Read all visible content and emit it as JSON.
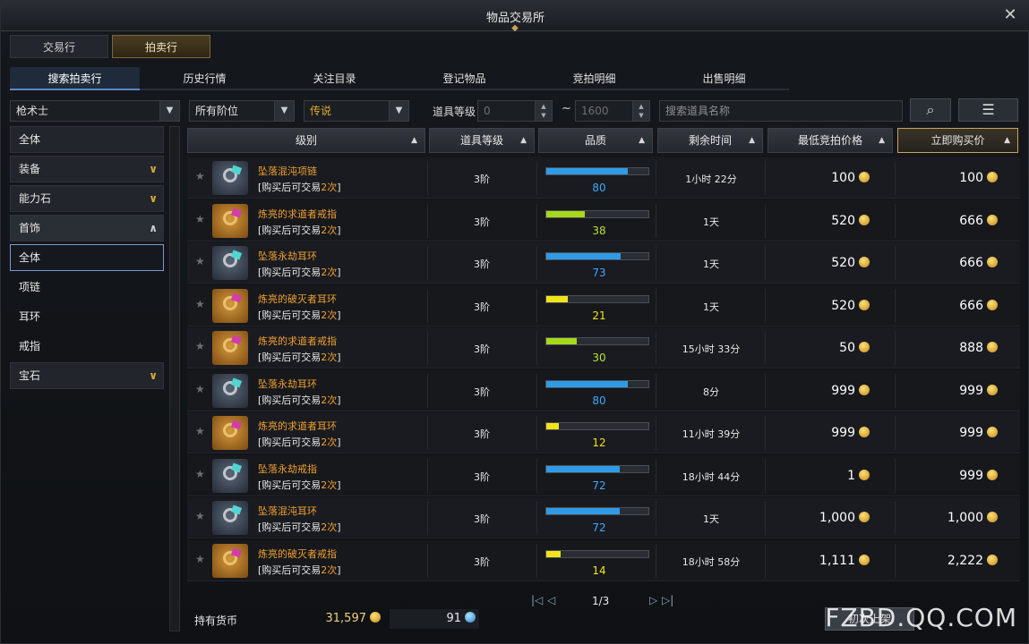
{
  "window": {
    "title": "物品交易所"
  },
  "main_tabs": [
    {
      "label": "交易行"
    },
    {
      "label": "拍卖行"
    }
  ],
  "sub_tabs": [
    {
      "label": "搜索拍卖行"
    },
    {
      "label": "历史行情"
    },
    {
      "label": "关注目录"
    },
    {
      "label": "登记物品"
    },
    {
      "label": "竞拍明细"
    },
    {
      "label": "出售明细"
    }
  ],
  "filters": {
    "class_value": "枪术士",
    "tier_value": "所有阶位",
    "grade_value": "传说",
    "item_level_label": "道具等级",
    "level_min_placeholder": "0",
    "level_max_placeholder": "1600",
    "search_placeholder": "搜索道具名称"
  },
  "sidebar": {
    "categories": [
      {
        "label": "全体"
      },
      {
        "label": "装备"
      },
      {
        "label": "能力石"
      },
      {
        "label": "首饰"
      }
    ],
    "subcategories": [
      {
        "label": "全体"
      },
      {
        "label": "项链"
      },
      {
        "label": "耳环"
      },
      {
        "label": "戒指"
      }
    ],
    "last_category": {
      "label": "宝石"
    }
  },
  "table": {
    "columns": [
      "级别",
      "道具等级",
      "品质",
      "剩余时间",
      "最低竞拍价格",
      "立即购买价"
    ],
    "rows": [
      {
        "name": "坠落混沌项链",
        "note_pre": "[购买后可交易",
        "note_hl": "2次",
        "note_post": "]",
        "tier": "3阶",
        "quality": 80,
        "time": "1小时 22分",
        "min_bid": "100",
        "buy_now": "100",
        "thumb": "blue"
      },
      {
        "name": "炼亮的求道者戒指",
        "note_pre": "[购买后可交易",
        "note_hl": "2次",
        "note_post": "]",
        "tier": "3阶",
        "quality": 38,
        "time": "1天",
        "min_bid": "520",
        "buy_now": "666",
        "thumb": "ring"
      },
      {
        "name": "坠落永劫耳环",
        "note_pre": "[购买后可交易",
        "note_hl": "2次",
        "note_post": "]",
        "tier": "3阶",
        "quality": 73,
        "time": "1天",
        "min_bid": "520",
        "buy_now": "666",
        "thumb": "blue"
      },
      {
        "name": "炼亮的破灭者耳环",
        "note_pre": "[购买后可交易",
        "note_hl": "2次",
        "note_post": "]",
        "tier": "3阶",
        "quality": 21,
        "time": "1天",
        "min_bid": "520",
        "buy_now": "666",
        "thumb": "ring"
      },
      {
        "name": "炼亮的求道者戒指",
        "note_pre": "[购买后可交易",
        "note_hl": "2次",
        "note_post": "]",
        "tier": "3阶",
        "quality": 30,
        "time": "15小时 33分",
        "min_bid": "50",
        "buy_now": "888",
        "thumb": "ring"
      },
      {
        "name": "坠落永劫耳环",
        "note_pre": "[购买后可交易",
        "note_hl": "2次",
        "note_post": "]",
        "tier": "3阶",
        "quality": 80,
        "time": "8分",
        "min_bid": "999",
        "buy_now": "999",
        "thumb": "blue"
      },
      {
        "name": "炼亮的求道者耳环",
        "note_pre": "[购买后可交易",
        "note_hl": "2次",
        "note_post": "]",
        "tier": "3阶",
        "quality": 12,
        "time": "11小时 39分",
        "min_bid": "999",
        "buy_now": "999",
        "thumb": "ring"
      },
      {
        "name": "坠落永劫戒指",
        "note_pre": "[购买后可交易",
        "note_hl": "2次",
        "note_post": "]",
        "tier": "3阶",
        "quality": 72,
        "time": "18小时 44分",
        "min_bid": "1",
        "buy_now": "999",
        "thumb": "blue"
      },
      {
        "name": "坠落混沌耳环",
        "note_pre": "[购买后可交易",
        "note_hl": "2次",
        "note_post": "]",
        "tier": "3阶",
        "quality": 72,
        "time": "1天",
        "min_bid": "1,000",
        "buy_now": "1,000",
        "thumb": "blue"
      },
      {
        "name": "炼亮的破灭者戒指",
        "note_pre": "[购买后可交易",
        "note_hl": "2次",
        "note_post": "]",
        "tier": "3阶",
        "quality": 14,
        "time": "18小时 58分",
        "min_bid": "1,111",
        "buy_now": "2,222",
        "thumb": "ring"
      }
    ]
  },
  "pagination": {
    "page": "1/3"
  },
  "footer": {
    "currency_label": "持有货币",
    "gold": "31,597",
    "gems": "91",
    "action_label": "初次上架"
  },
  "watermark": "FZBD.QQ.COM",
  "colors": {
    "accent_gold": "#f0a030",
    "quality_blue": "#2f9be6",
    "quality_green": "#a6d81c",
    "quality_yellow": "#f2e31a"
  }
}
